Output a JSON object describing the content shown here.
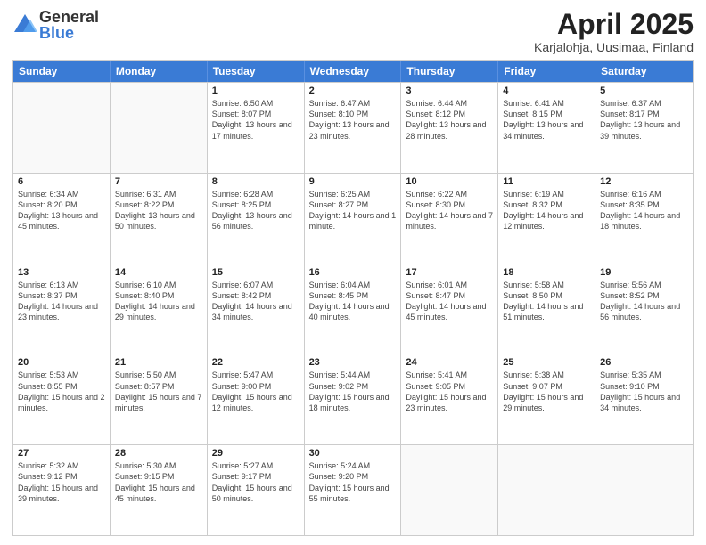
{
  "logo": {
    "general": "General",
    "blue": "Blue"
  },
  "title": "April 2025",
  "subtitle": "Karjalohja, Uusimaa, Finland",
  "days": [
    "Sunday",
    "Monday",
    "Tuesday",
    "Wednesday",
    "Thursday",
    "Friday",
    "Saturday"
  ],
  "weeks": [
    [
      {
        "day": "",
        "info": ""
      },
      {
        "day": "",
        "info": ""
      },
      {
        "day": "1",
        "info": "Sunrise: 6:50 AM\nSunset: 8:07 PM\nDaylight: 13 hours\nand 17 minutes."
      },
      {
        "day": "2",
        "info": "Sunrise: 6:47 AM\nSunset: 8:10 PM\nDaylight: 13 hours\nand 23 minutes."
      },
      {
        "day": "3",
        "info": "Sunrise: 6:44 AM\nSunset: 8:12 PM\nDaylight: 13 hours\nand 28 minutes."
      },
      {
        "day": "4",
        "info": "Sunrise: 6:41 AM\nSunset: 8:15 PM\nDaylight: 13 hours\nand 34 minutes."
      },
      {
        "day": "5",
        "info": "Sunrise: 6:37 AM\nSunset: 8:17 PM\nDaylight: 13 hours\nand 39 minutes."
      }
    ],
    [
      {
        "day": "6",
        "info": "Sunrise: 6:34 AM\nSunset: 8:20 PM\nDaylight: 13 hours\nand 45 minutes."
      },
      {
        "day": "7",
        "info": "Sunrise: 6:31 AM\nSunset: 8:22 PM\nDaylight: 13 hours\nand 50 minutes."
      },
      {
        "day": "8",
        "info": "Sunrise: 6:28 AM\nSunset: 8:25 PM\nDaylight: 13 hours\nand 56 minutes."
      },
      {
        "day": "9",
        "info": "Sunrise: 6:25 AM\nSunset: 8:27 PM\nDaylight: 14 hours\nand 1 minute."
      },
      {
        "day": "10",
        "info": "Sunrise: 6:22 AM\nSunset: 8:30 PM\nDaylight: 14 hours\nand 7 minutes."
      },
      {
        "day": "11",
        "info": "Sunrise: 6:19 AM\nSunset: 8:32 PM\nDaylight: 14 hours\nand 12 minutes."
      },
      {
        "day": "12",
        "info": "Sunrise: 6:16 AM\nSunset: 8:35 PM\nDaylight: 14 hours\nand 18 minutes."
      }
    ],
    [
      {
        "day": "13",
        "info": "Sunrise: 6:13 AM\nSunset: 8:37 PM\nDaylight: 14 hours\nand 23 minutes."
      },
      {
        "day": "14",
        "info": "Sunrise: 6:10 AM\nSunset: 8:40 PM\nDaylight: 14 hours\nand 29 minutes."
      },
      {
        "day": "15",
        "info": "Sunrise: 6:07 AM\nSunset: 8:42 PM\nDaylight: 14 hours\nand 34 minutes."
      },
      {
        "day": "16",
        "info": "Sunrise: 6:04 AM\nSunset: 8:45 PM\nDaylight: 14 hours\nand 40 minutes."
      },
      {
        "day": "17",
        "info": "Sunrise: 6:01 AM\nSunset: 8:47 PM\nDaylight: 14 hours\nand 45 minutes."
      },
      {
        "day": "18",
        "info": "Sunrise: 5:58 AM\nSunset: 8:50 PM\nDaylight: 14 hours\nand 51 minutes."
      },
      {
        "day": "19",
        "info": "Sunrise: 5:56 AM\nSunset: 8:52 PM\nDaylight: 14 hours\nand 56 minutes."
      }
    ],
    [
      {
        "day": "20",
        "info": "Sunrise: 5:53 AM\nSunset: 8:55 PM\nDaylight: 15 hours\nand 2 minutes."
      },
      {
        "day": "21",
        "info": "Sunrise: 5:50 AM\nSunset: 8:57 PM\nDaylight: 15 hours\nand 7 minutes."
      },
      {
        "day": "22",
        "info": "Sunrise: 5:47 AM\nSunset: 9:00 PM\nDaylight: 15 hours\nand 12 minutes."
      },
      {
        "day": "23",
        "info": "Sunrise: 5:44 AM\nSunset: 9:02 PM\nDaylight: 15 hours\nand 18 minutes."
      },
      {
        "day": "24",
        "info": "Sunrise: 5:41 AM\nSunset: 9:05 PM\nDaylight: 15 hours\nand 23 minutes."
      },
      {
        "day": "25",
        "info": "Sunrise: 5:38 AM\nSunset: 9:07 PM\nDaylight: 15 hours\nand 29 minutes."
      },
      {
        "day": "26",
        "info": "Sunrise: 5:35 AM\nSunset: 9:10 PM\nDaylight: 15 hours\nand 34 minutes."
      }
    ],
    [
      {
        "day": "27",
        "info": "Sunrise: 5:32 AM\nSunset: 9:12 PM\nDaylight: 15 hours\nand 39 minutes."
      },
      {
        "day": "28",
        "info": "Sunrise: 5:30 AM\nSunset: 9:15 PM\nDaylight: 15 hours\nand 45 minutes."
      },
      {
        "day": "29",
        "info": "Sunrise: 5:27 AM\nSunset: 9:17 PM\nDaylight: 15 hours\nand 50 minutes."
      },
      {
        "day": "30",
        "info": "Sunrise: 5:24 AM\nSunset: 9:20 PM\nDaylight: 15 hours\nand 55 minutes."
      },
      {
        "day": "",
        "info": ""
      },
      {
        "day": "",
        "info": ""
      },
      {
        "day": "",
        "info": ""
      }
    ]
  ]
}
